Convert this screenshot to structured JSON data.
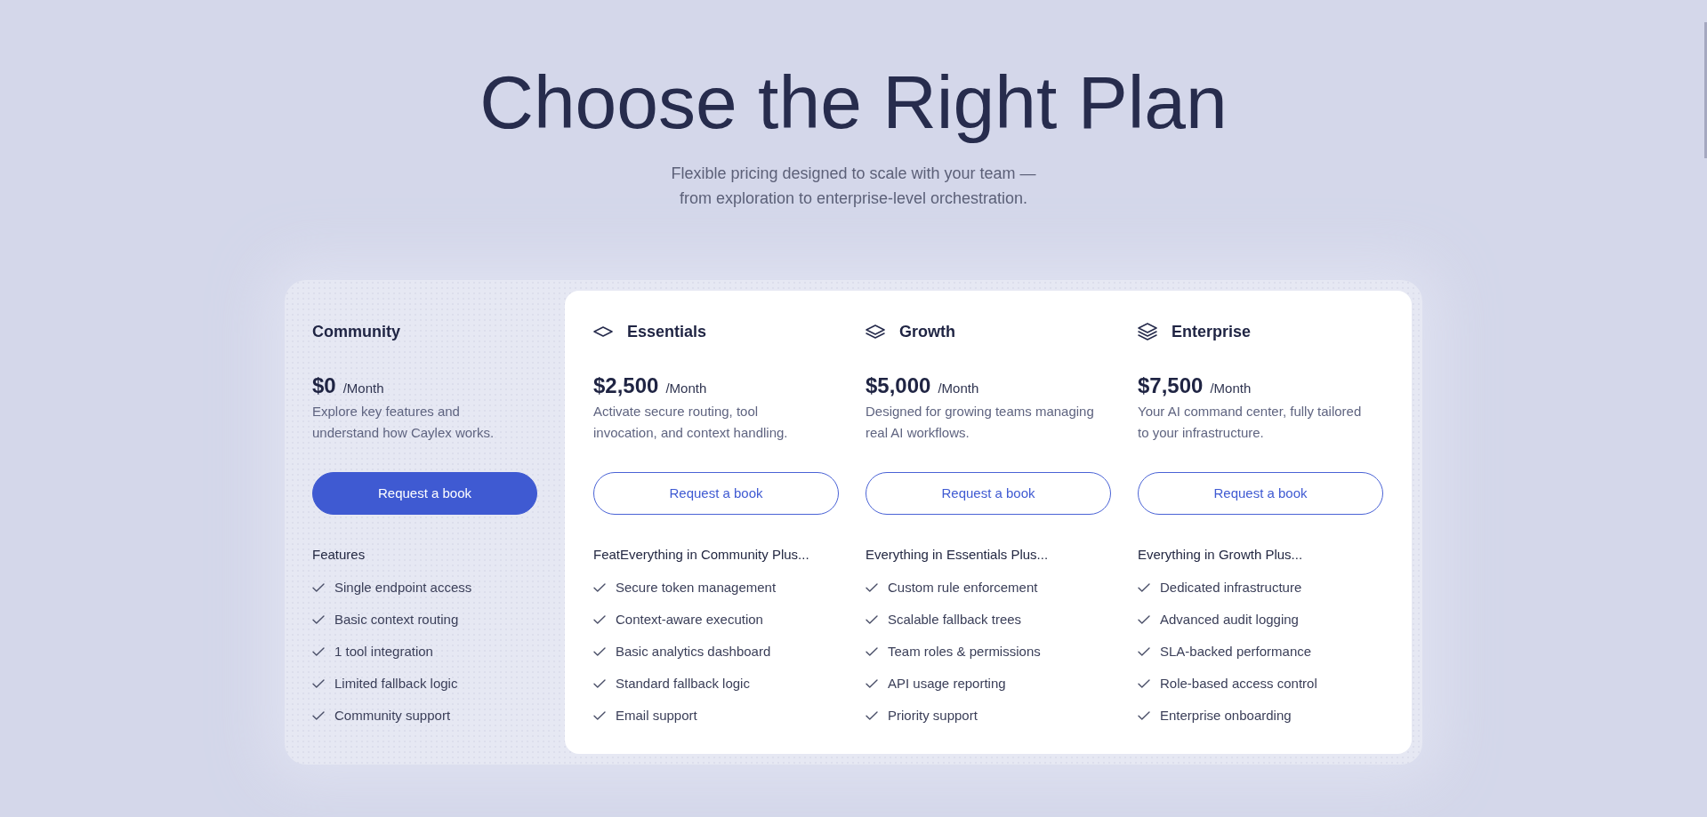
{
  "header": {
    "title": "Choose the Right Plan",
    "subtitle": "Flexible pricing designed to scale with your team —\nfrom exploration to enterprise-level orchestration."
  },
  "plans": [
    {
      "kind": "free",
      "name": "Community",
      "price": "$0",
      "period": "/Month",
      "description": "Explore key features and\nunderstand how Caylex works.",
      "button": {
        "label": "Request a book",
        "filled": true
      },
      "features_heading": "Features",
      "features": [
        "Single endpoint access",
        "Basic context routing",
        "1 tool integration",
        "Limited fallback logic",
        "Community support"
      ]
    },
    {
      "kind": "basic",
      "name": "Essentials",
      "price": "$2,500",
      "period": "/Month",
      "description": "Activate secure routing, tool\ninvocation, and context handling.",
      "button": {
        "label": "Request a book",
        "filled": false
      },
      "features_heading": "FeatEverything in Community Plus...",
      "features": [
        "Secure token management",
        "Context-aware execution",
        "Basic analytics dashboard",
        "Standard fallback logic",
        "Email support"
      ]
    },
    {
      "kind": "pro",
      "name": "Growth",
      "price": "$5,000",
      "period": "/Month",
      "description": "Designed for growing teams managing\nreal AI workflows.",
      "button": {
        "label": "Request a book",
        "filled": false
      },
      "features_heading": "Everything in Essentials Plus...",
      "features": [
        "Custom rule enforcement",
        "Scalable fallback trees",
        "Team roles & permissions",
        "API usage reporting",
        "Priority support"
      ]
    },
    {
      "kind": "premium",
      "name": "Enterprise",
      "price": "$7,500",
      "period": "/Month",
      "description": "Your AI command center, fully tailored\nto your infrastructure.",
      "button": {
        "label": "Request a book",
        "filled": false
      },
      "features_heading": "Everything in Growth Plus...",
      "features": [
        "Dedicated infrastructure",
        "Advanced audit logging",
        "SLA-backed performance",
        "Role-based access control",
        "Enterprise onboarding"
      ]
    }
  ]
}
